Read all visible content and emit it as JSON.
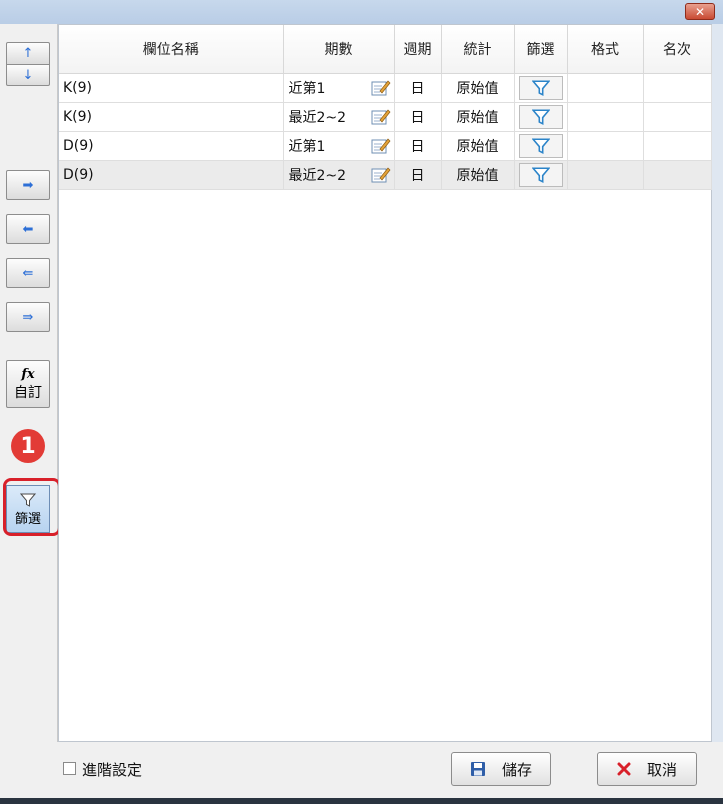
{
  "window": {
    "close_label": "✕"
  },
  "sidebar": {
    "up_glyph": "↑",
    "down_glyph": "↓",
    "move_right_glyph": "➡",
    "move_left_glyph": "⬅",
    "move_all_left_glyph": "⇚",
    "move_all_right_glyph": "⇛",
    "custom_fx": "fx",
    "custom_label": "自訂",
    "filter_label": "篩選",
    "callout_number": "1"
  },
  "table": {
    "headers": [
      "欄位名稱",
      "期數",
      "週期",
      "統計",
      "篩選",
      "格式",
      "名次"
    ],
    "rows": [
      {
        "name": "K(9)",
        "period": "近第1",
        "cycle": "日",
        "stat": "原始值",
        "format": "",
        "rank": ""
      },
      {
        "name": "K(9)",
        "period": "最近2~2",
        "cycle": "日",
        "stat": "原始值",
        "format": "",
        "rank": ""
      },
      {
        "name": "D(9)",
        "period": "近第1",
        "cycle": "日",
        "stat": "原始值",
        "format": "",
        "rank": ""
      },
      {
        "name": "D(9)",
        "period": "最近2~2",
        "cycle": "日",
        "stat": "原始值",
        "format": "",
        "rank": ""
      }
    ],
    "selected_row": 3
  },
  "footer": {
    "advanced_label": "進階設定",
    "save_label": "儲存",
    "cancel_label": "取消"
  },
  "colors": {
    "accent": "#2d6fd6",
    "callout": "#e23b36",
    "highlight": "#d8202a"
  }
}
